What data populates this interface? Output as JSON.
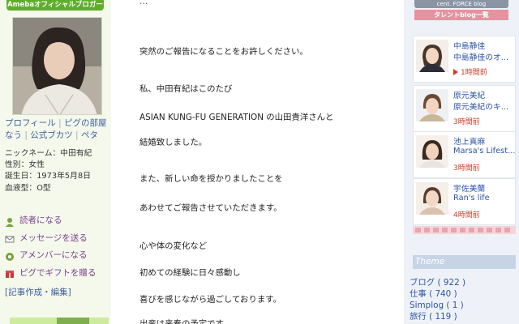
{
  "sidebar": {
    "badge": "Amebaオフィシャルブロガー",
    "links": [
      "プロフィール",
      "ピグの部屋",
      "なう",
      "公式ブカツ",
      "ペタ"
    ],
    "profile": [
      {
        "label": "ニックネーム：",
        "value": "中田有紀"
      },
      {
        "label": "性別：",
        "value": "女性"
      },
      {
        "label": "誕生日：",
        "value": "1973年5月8日"
      },
      {
        "label": "血液型：",
        "value": "O型"
      }
    ],
    "actions": [
      {
        "label": "読者になる",
        "icon": "reader-icon"
      },
      {
        "label": "メッセージを送る",
        "icon": "mail-icon"
      },
      {
        "label": "アメンバーになる",
        "icon": "member-icon"
      },
      {
        "label": "ピグでギフトを贈る",
        "icon": "gift-icon"
      }
    ],
    "edit_link": "[記事作成・編集]"
  },
  "article": {
    "paragraphs": [
      "突然のご報告になることをお許しください。",
      "私、中田有紀はこのたび",
      "ASIAN KUNG-FU GENERATION の山田貴洋さんと",
      "結婚致しました。",
      "また、新しい命を授かりましたことを",
      "あわせてご報告させていただきます。",
      "心や体の変化など",
      "初めての経験に日々感動し",
      "喜びを感じながら過ごしております。",
      "出産は来春の予定です"
    ]
  },
  "right": {
    "header": "cent. FORCE blog",
    "subheader": "タレントblog一覧",
    "cards": [
      {
        "name": "中島静佳",
        "blog": "中島静佳のオ...",
        "time": "1時間前",
        "has_play": true
      },
      {
        "name": "原元美紀",
        "blog": "原元美紀のキ...",
        "time": "3時間前",
        "has_play": false
      },
      {
        "name": "池上真麻",
        "blog": "Marsa's Lifest...",
        "time": "3時間前",
        "has_play": false
      },
      {
        "name": "宇佐美蘭",
        "blog": "Ran's life",
        "time": "4時間前",
        "has_play": false
      }
    ],
    "theme_title": "Theme",
    "categories": [
      {
        "name": "ブログ",
        "count": "( 922 )"
      },
      {
        "name": "仕事",
        "count": "( 740 )"
      },
      {
        "name": "Simplog",
        "count": "( 1 )"
      },
      {
        "name": "旅行",
        "count": "( 119 )"
      }
    ]
  },
  "colors": {
    "left_bg": "#f4f9ec",
    "badge_green": "#5fae2b",
    "link_blue": "#3f5f9a",
    "action_purple": "#7b3f8a",
    "right_bg": "#eef2f8",
    "time_red": "#d03c2a",
    "tab_pink": "#e8919f"
  }
}
